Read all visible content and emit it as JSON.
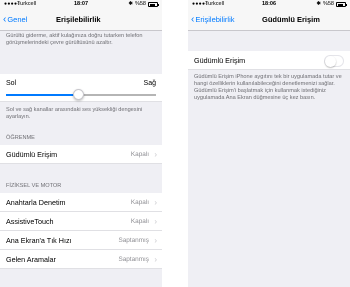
{
  "left": {
    "status": {
      "carrier": "Turkcell",
      "time": "18:07",
      "battery_pct": "%58"
    },
    "nav": {
      "back_label": "Genel",
      "title": "Erişilebilirlik"
    },
    "top_footnote": "Gürültü giderme, aktif kulağınıza doğru tutarken telefon görüşmelerindeki çevre gürültüsünü azaltır.",
    "slider": {
      "left_label": "Sol",
      "right_label": "Sağ",
      "position": 0.45
    },
    "slider_footnote": "Sol ve sağ kanallar arasındaki ses yüksekliği dengesini ayarlayın.",
    "section_learning": "ÖĞRENME",
    "guided_access": {
      "label": "Güdümlü Erişim",
      "value": "Kapalı"
    },
    "section_physical": "FİZİKSEL VE MOTOR",
    "rows": [
      {
        "label": "Anahtarla Denetim",
        "value": "Kapalı"
      },
      {
        "label": "AssistiveTouch",
        "value": "Kapalı"
      },
      {
        "label": "Ana Ekran'a Tık Hızı",
        "value": "Saptanmış"
      },
      {
        "label": "Gelen Aramalar",
        "value": "Saptanmış"
      }
    ]
  },
  "right": {
    "status": {
      "carrier": "Turkcell",
      "time": "18:06",
      "battery_pct": "%58"
    },
    "nav": {
      "back_label": "Erişilebilirlik",
      "title": "Güdümlü Erişim"
    },
    "toggle": {
      "label": "Güdümlü Erişim",
      "on": false
    },
    "description": "Güdümlü Erişim iPhone aygıtını tek bir uygulamada tutar ve hangi özelliklerin kullanılabileceğini denetlemenizi sağlar. Güdümlü Erişim'i başlatmak için kullanmak istediğiniz uygulamada Ana Ekran düğmesine üç kez basın."
  },
  "colors": {
    "accent": "#007aff",
    "background": "#efeff4",
    "secondary_text": "#8e8e93"
  }
}
